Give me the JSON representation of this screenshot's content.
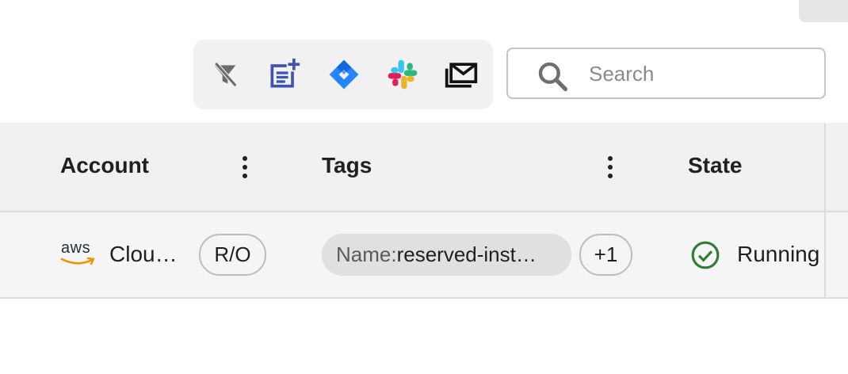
{
  "toolbar": {
    "items": [
      {
        "icon": "filter-off-icon",
        "color": "#6b6b6b"
      },
      {
        "icon": "note-add-icon",
        "color": "#3f51b5"
      },
      {
        "icon": "jira-icon",
        "color": "#2684ff"
      },
      {
        "icon": "slack-icon",
        "colors": [
          "#e01e5a",
          "#36c5f0",
          "#2eb67d",
          "#ecb22e"
        ]
      },
      {
        "icon": "mail-stack-icon",
        "color": "#111111"
      }
    ]
  },
  "search": {
    "placeholder": "Search",
    "value": ""
  },
  "table": {
    "columns": [
      {
        "title": "Account"
      },
      {
        "title": "Tags"
      },
      {
        "title": "State"
      }
    ],
    "rows": [
      {
        "provider": "aws",
        "account": "Clou…",
        "access": "R/O",
        "tag_key": "Name: ",
        "tag_value": "reserved-inst…",
        "tag_more": "+1",
        "state": "Running",
        "state_color": "#2e7d32"
      }
    ]
  },
  "colors": {
    "aws_orange": "#f29100",
    "running_green": "#2e7d32"
  }
}
